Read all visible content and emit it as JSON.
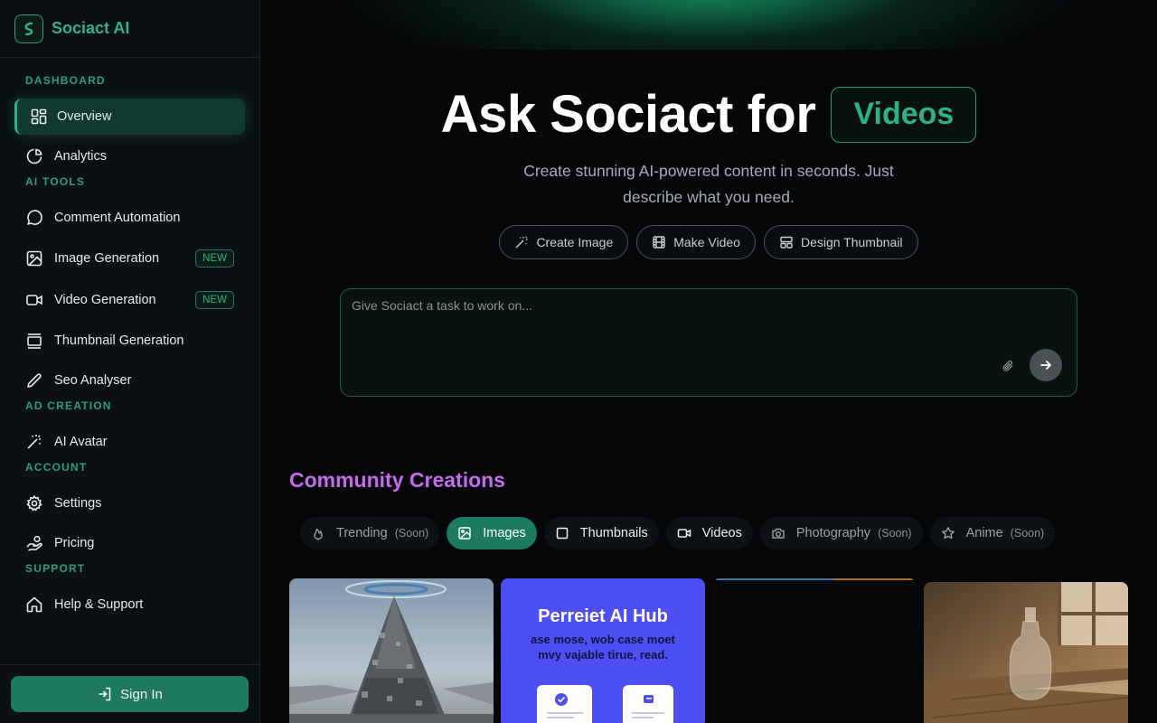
{
  "brand": {
    "name": "Sociact AI"
  },
  "sidebar": {
    "sections": {
      "dashboard": "DASHBOARD",
      "ai_tools": "AI TOOLS",
      "ad_creation": "AD CREATION",
      "account": "ACCOUNT",
      "support": "SUPPORT"
    },
    "items": {
      "overview": "Overview",
      "analytics": "Analytics",
      "comment_automation": "Comment Automation",
      "image_generation": "Image Generation",
      "video_generation": "Video Generation",
      "thumbnail_generation": "Thumbnail Generation",
      "seo_analyser": "Seo Analyser",
      "ai_avatar": "AI Avatar",
      "settings": "Settings",
      "pricing": "Pricing",
      "help_support": "Help & Support"
    },
    "badge_new": "NEW",
    "sign_in": "Sign In"
  },
  "hero": {
    "title": "Ask Sociact for",
    "highlight": "Videos",
    "subtitle": "Create stunning AI-powered content in seconds. Just describe what you need."
  },
  "quick_actions": {
    "create_image": "Create Image",
    "make_video": "Make Video",
    "design_thumbnail": "Design Thumbnail"
  },
  "prompt": {
    "placeholder": "Give Sociact a task to work on..."
  },
  "community": {
    "title": "Community Creations",
    "soon": "(Soon)",
    "filters": {
      "trending": "Trending",
      "images": "Images",
      "thumbnails": "Thumbnails",
      "videos": "Videos",
      "photography": "Photography",
      "anime": "Anime"
    }
  },
  "cards": {
    "hub_title": "Perreiet AI Hub",
    "hub_sub": "ase mose, wob case moet mvy vajable tirue, read."
  },
  "colors": {
    "accent": "#2fb088",
    "accent_dark": "#1d7a60",
    "community_title": "#c56bf0",
    "background": "#050608"
  }
}
